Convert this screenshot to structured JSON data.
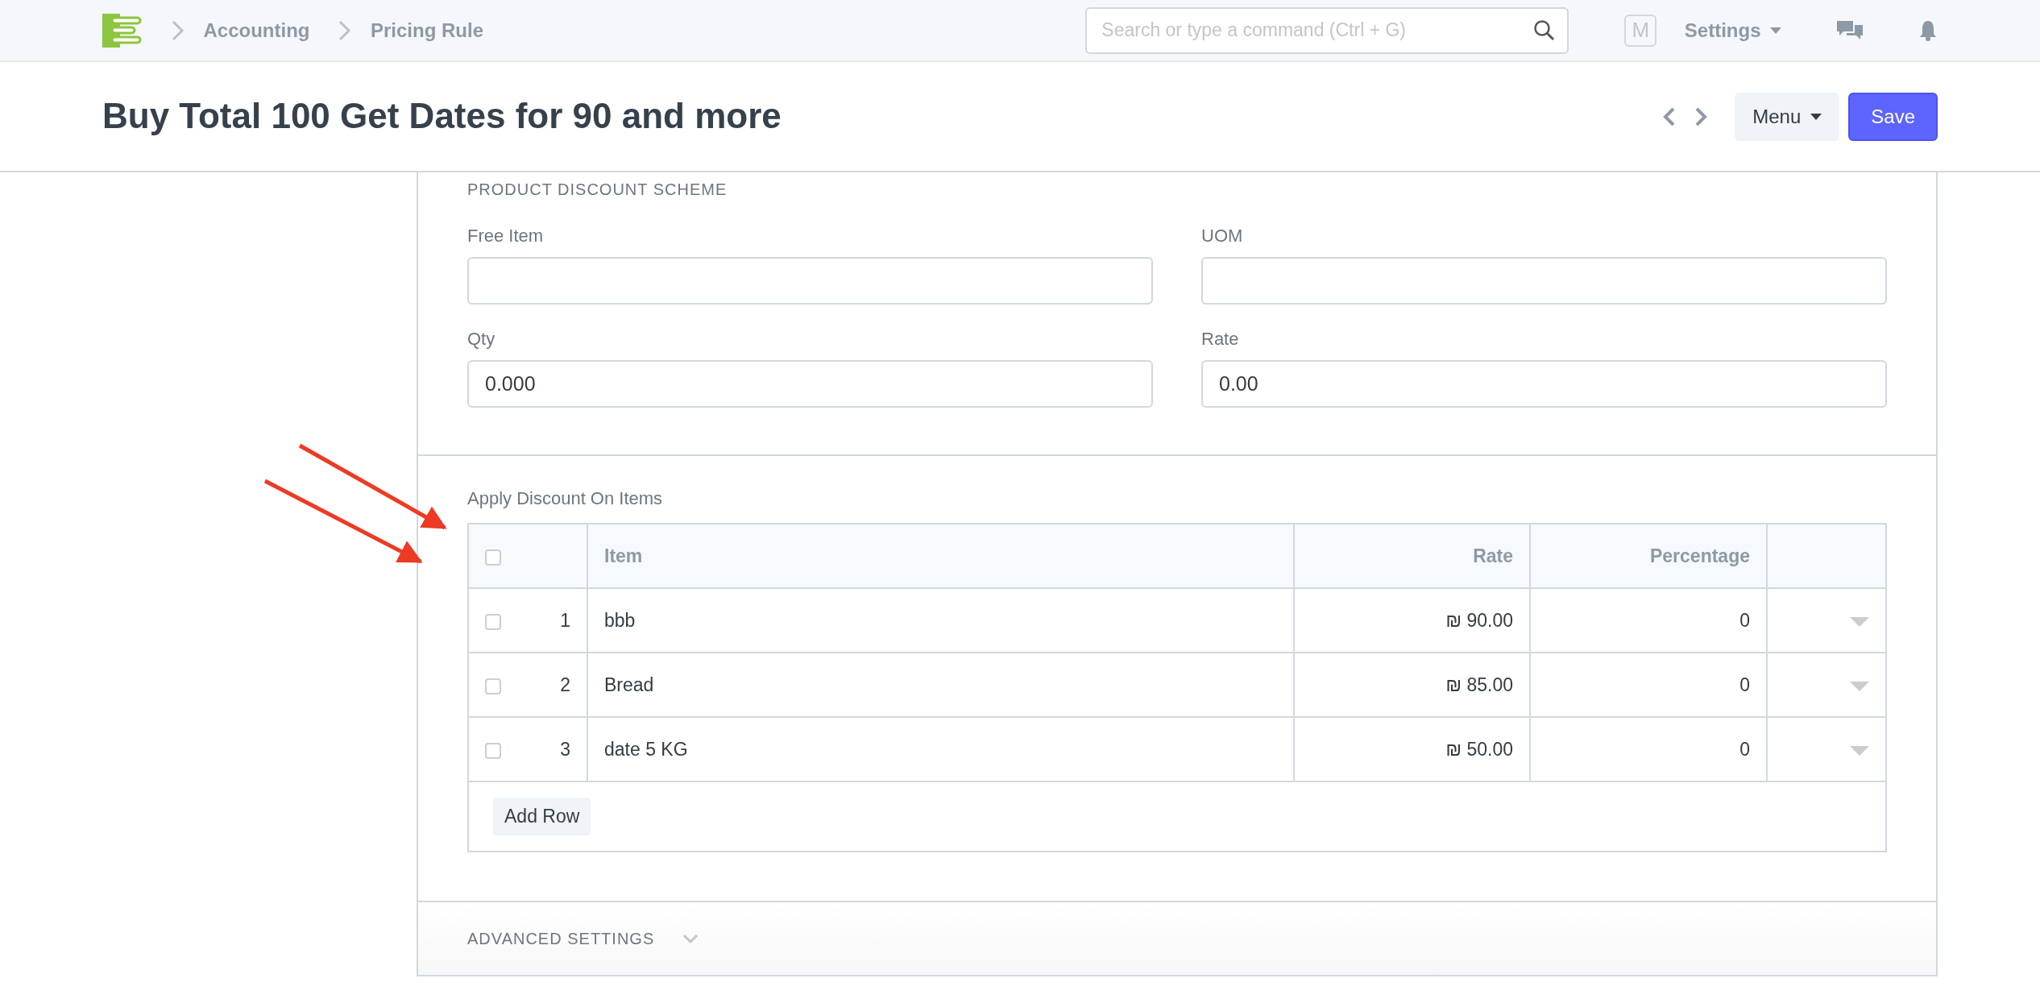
{
  "navbar": {
    "breadcrumbs": [
      "Accounting",
      "Pricing Rule"
    ],
    "search": {
      "placeholder": "Search or type a command (Ctrl + G)"
    },
    "avatar": "M",
    "settings": "Settings"
  },
  "page": {
    "title": "Buy Total 100 Get Dates for 90 and more",
    "menu": "Menu",
    "save": "Save"
  },
  "sections": [
    {
      "kind": "fields",
      "heading": "PRODUCT DISCOUNT SCHEME",
      "fields": [
        {
          "label": "Free Item"
        },
        {
          "label": "UOM"
        },
        {
          "label": "Qty",
          "value": "0.000"
        },
        {
          "label": "Rate",
          "value": "0.00"
        }
      ]
    },
    {
      "kind": "table",
      "label": "Apply Discount On Items",
      "all_selected": false,
      "columns": [
        "Item",
        "Rate",
        "Percentage"
      ],
      "rows": [
        {
          "no": "1",
          "item": "bbb",
          "rate": "₪ 90.00",
          "percentage": "0",
          "selected": false
        },
        {
          "no": "2",
          "item": "Bread",
          "rate": "₪ 85.00",
          "percentage": "0",
          "selected": false
        },
        {
          "no": "3",
          "item": "date 5 KG",
          "rate": "₪ 50.00",
          "percentage": "0",
          "selected": false
        }
      ],
      "add_row": "Add Row"
    },
    {
      "kind": "collapsible",
      "heading": "ADVANCED SETTINGS",
      "expanded": false
    }
  ]
}
